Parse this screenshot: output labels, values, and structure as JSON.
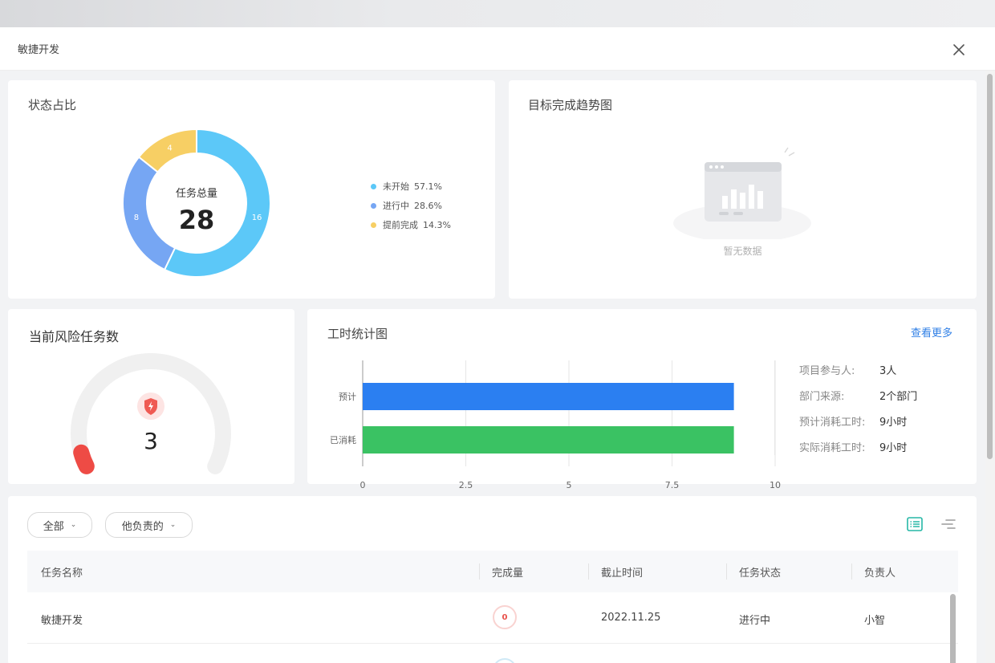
{
  "dialog": {
    "title": "敏捷开发"
  },
  "status_card": {
    "title": "状态占比",
    "center_label": "任务总量",
    "total": "28",
    "segments": [
      {
        "label": "未开始",
        "value": 16,
        "percent": "57.1%",
        "color": "#5cc8f8"
      },
      {
        "label": "进行中",
        "value": 8,
        "percent": "28.6%",
        "color": "#76a6f3"
      },
      {
        "label": "提前完成",
        "value": 4,
        "percent": "14.3%",
        "color": "#f7cf64"
      }
    ]
  },
  "trend_card": {
    "title": "目标完成趋势图",
    "empty_text": "暂无数据"
  },
  "risk_card": {
    "title": "当前风险任务数",
    "count": "3",
    "gauge_fraction": 0.05,
    "colors": {
      "track": "#f0f0f0",
      "fill": "#ee4b45"
    }
  },
  "hours_card": {
    "title": "工时统计图",
    "view_more": "查看更多",
    "info": [
      {
        "label": "项目参与人:",
        "value": "3人"
      },
      {
        "label": "部门来源:",
        "value": "2个部门"
      },
      {
        "label": "预计消耗工时:",
        "value": "9小时"
      },
      {
        "label": "实际消耗工时:",
        "value": "9小时"
      }
    ]
  },
  "chart_data": {
    "type": "bar",
    "orientation": "horizontal",
    "categories": [
      "预计",
      "已消耗"
    ],
    "values": [
      9,
      9
    ],
    "colors": [
      "#2b7ff1",
      "#3ac263"
    ],
    "xlim": [
      0,
      10
    ],
    "xticks": [
      "0",
      "2.5",
      "5",
      "7.5",
      "10"
    ],
    "grid": true
  },
  "table_card": {
    "filters": [
      {
        "label": "全部"
      },
      {
        "label": "他负责的"
      }
    ],
    "columns": [
      "任务名称",
      "完成量",
      "截止时间",
      "任务状态",
      "负责人"
    ],
    "rows": [
      {
        "name": "敏捷开发",
        "progress": "0",
        "deadline": "2022.11.25",
        "status": "进行中",
        "owner": "小智"
      }
    ],
    "colors": {
      "accent": "#26b7a6"
    }
  }
}
